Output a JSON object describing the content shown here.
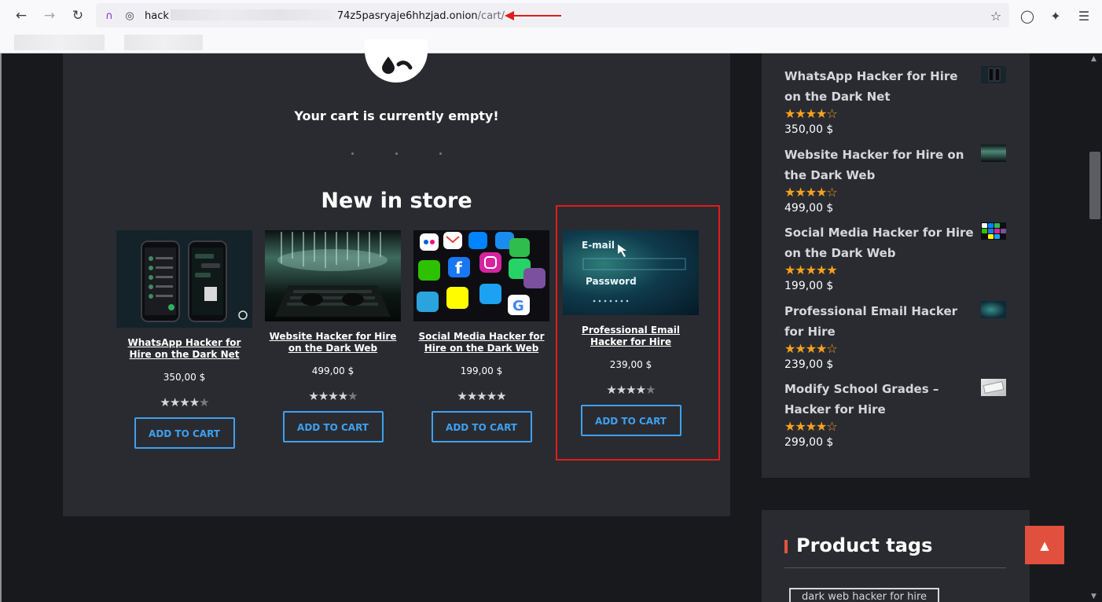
{
  "browser": {
    "url_prefix": "hack",
    "url_suffix": "74z5pasryaje6hhzjad.onion",
    "url_path": "/cart/",
    "icons": [
      "back-icon",
      "forward-icon",
      "reload-icon",
      "tor-circuit-icon",
      "onion-icon",
      "bookmark-star-icon",
      "shield-icon",
      "extensions-icon",
      "menu-icon"
    ]
  },
  "cart": {
    "empty_message": "Your cart is currently empty!"
  },
  "new_in_store": {
    "title": "New in store",
    "products": [
      {
        "name": "WhatsApp Hacker for Hire on the Dark Net",
        "price": "350,00 $",
        "rating": 4.5,
        "button": "ADD TO CART"
      },
      {
        "name": "Website Hacker for Hire on the Dark Web",
        "price": "499,00 $",
        "rating": 4,
        "button": "ADD TO CART"
      },
      {
        "name": "Social Media Hacker for Hire on the Dark Web",
        "price": "199,00 $",
        "rating": 5,
        "button": "ADD TO CART"
      },
      {
        "name": "Professional Email Hacker for Hire",
        "price": "239,00 $",
        "rating": 4.5,
        "button": "ADD TO CART",
        "thumb_text": {
          "line1": "E-mail",
          "line2": "Password"
        }
      }
    ]
  },
  "sidebar": {
    "products": [
      {
        "name": "WhatsApp Hacker for Hire on the Dark Net",
        "price": "350,00 $",
        "rating": 4.5
      },
      {
        "name": "Website Hacker for Hire on the Dark Web",
        "price": "499,00 $",
        "rating": 4
      },
      {
        "name": "Social Media Hacker for Hire on the Dark Web",
        "price": "199,00 $",
        "rating": 5
      },
      {
        "name": "Professional Email Hacker for Hire",
        "price": "239,00 $",
        "rating": 4.5
      },
      {
        "name": "Modify School Grades – Hacker for Hire",
        "price": "299,00 $",
        "rating": 4.5
      }
    ],
    "tags_title": "Product tags",
    "tags": [
      "dark web hacker for hire"
    ]
  },
  "colors": {
    "accent_blue": "#3fa0f0",
    "star_orange": "#f7a11c",
    "annotation_red": "#e31b1b",
    "back_to_top": "#e0503c"
  }
}
